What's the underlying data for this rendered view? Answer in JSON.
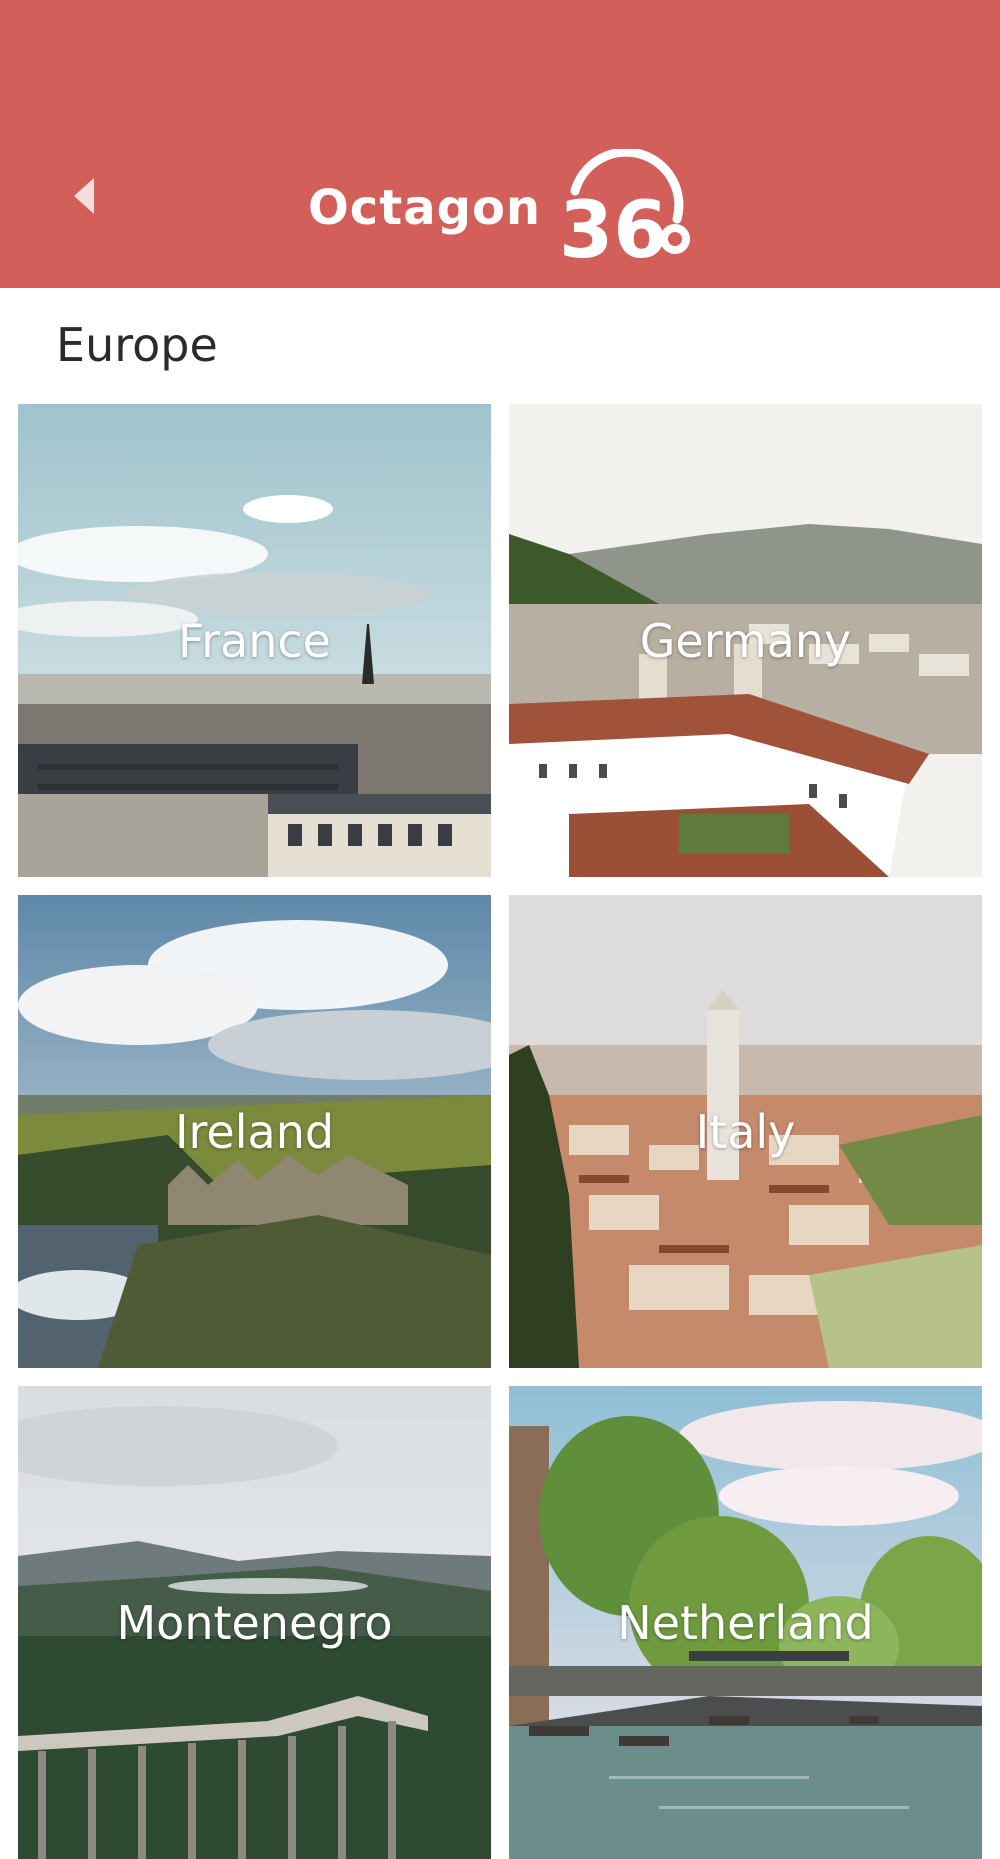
{
  "header": {
    "background_color": "#d35f5b",
    "back_icon": "back-arrow-icon",
    "logo_text": "Octagon",
    "logo_mark": "360"
  },
  "section": {
    "title": "Europe"
  },
  "countries": [
    {
      "label": "France"
    },
    {
      "label": "Germany"
    },
    {
      "label": "Ireland"
    },
    {
      "label": "Italy"
    },
    {
      "label": "Montenegro"
    },
    {
      "label": "Netherland"
    }
  ]
}
